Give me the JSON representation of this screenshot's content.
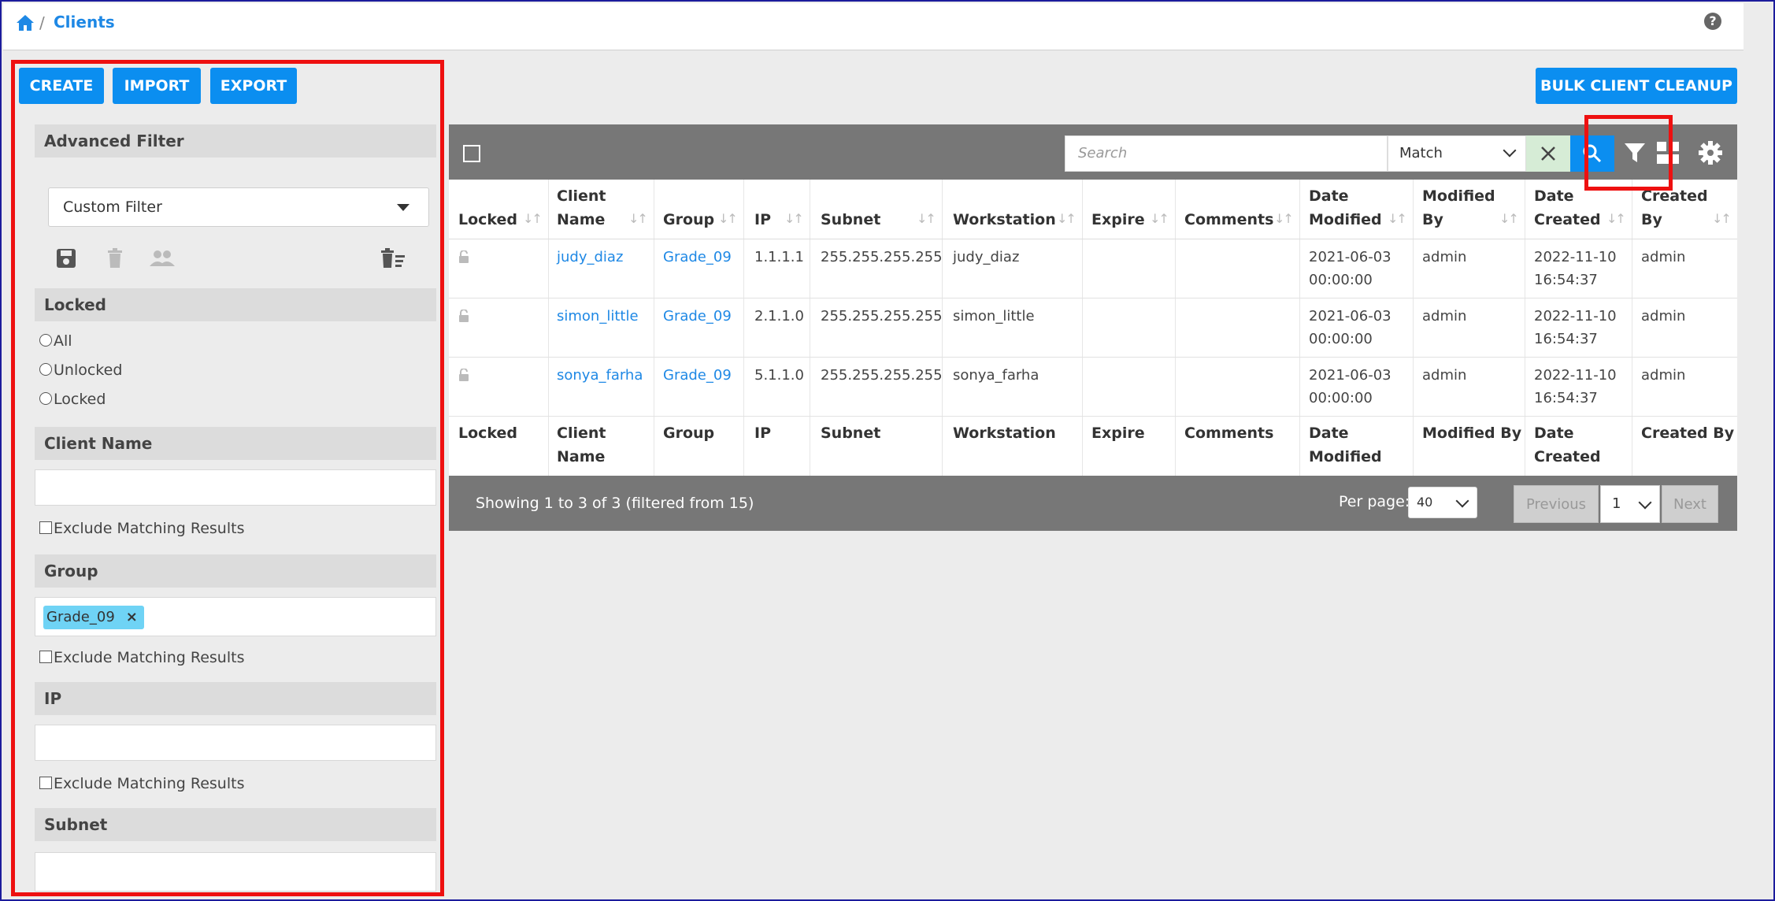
{
  "header": {
    "breadcrumb_sep": "/",
    "title": "Clients",
    "help": "?"
  },
  "actions": {
    "create": "CREATE",
    "import": "IMPORT",
    "export": "EXPORT",
    "bulk_cleanup": "BULK CLIENT CLEANUP"
  },
  "filter": {
    "title": "Advanced Filter",
    "selected_filter": "Custom Filter",
    "locked": {
      "title": "Locked",
      "options": [
        "All",
        "Unlocked",
        "Locked"
      ]
    },
    "client_name": {
      "title": "Client Name",
      "exclude": "Exclude Matching Results"
    },
    "group": {
      "title": "Group",
      "tag": "Grade_09",
      "tag_remove": "×",
      "exclude": "Exclude Matching Results"
    },
    "ip": {
      "title": "IP",
      "exclude": "Exclude Matching Results"
    },
    "subnet": {
      "title": "Subnet"
    }
  },
  "toolbar": {
    "search_placeholder": "Search",
    "match": "Match"
  },
  "table": {
    "headers": {
      "locked": "Locked",
      "client_name_1": "Client",
      "client_name_2": "Name",
      "group": "Group",
      "ip": "IP",
      "subnet": "Subnet",
      "workstation": "Workstation",
      "expire": "Expire",
      "comments": "Comments",
      "date_modified_1": "Date",
      "date_modified_2": "Modified",
      "modified_by_1": "Modified",
      "modified_by_2": "By",
      "date_created_1": "Date",
      "date_created_2": "Created",
      "created_by_1": "Created",
      "created_by_2": "By"
    },
    "footer": {
      "locked": "Locked",
      "client_name_1": "Client",
      "client_name_2": "Name",
      "group": "Group",
      "ip": "IP",
      "subnet": "Subnet",
      "workstation": "Workstation",
      "expire": "Expire",
      "comments": "Comments",
      "date_modified_1": "Date",
      "date_modified_2": "Modified",
      "modified_by": "Modified By",
      "date_created_1": "Date",
      "date_created_2": "Created",
      "created_by": "Created By"
    },
    "rows": [
      {
        "client_name": "judy_diaz",
        "group": "Grade_09",
        "ip": "1.1.1.1",
        "subnet": "255.255.255.255",
        "workstation": "judy_diaz",
        "date_modified_1": "2021-06-03",
        "date_modified_2": "00:00:00",
        "modified_by": "admin",
        "date_created_1": "2022-11-10",
        "date_created_2": "16:54:37",
        "created_by": "admin"
      },
      {
        "client_name": "simon_little",
        "group": "Grade_09",
        "ip": "2.1.1.0",
        "subnet": "255.255.255.255",
        "workstation": "simon_little",
        "date_modified_1": "2021-06-03",
        "date_modified_2": "00:00:00",
        "modified_by": "admin",
        "date_created_1": "2022-11-10",
        "date_created_2": "16:54:37",
        "created_by": "admin"
      },
      {
        "client_name": "sonya_farha",
        "group": "Grade_09",
        "ip": "5.1.1.0",
        "subnet": "255.255.255.255",
        "workstation": "sonya_farha",
        "date_modified_1": "2021-06-03",
        "date_modified_2": "00:00:00",
        "modified_by": "admin",
        "date_created_1": "2022-11-10",
        "date_created_2": "16:54:37",
        "created_by": "admin"
      }
    ]
  },
  "pagination": {
    "showing": "Showing 1 to 3 of 3 (filtered from 15)",
    "per_page_label": "Per page:",
    "per_page": "40",
    "previous": "Previous",
    "page": "1",
    "next": "Next"
  },
  "colors": {
    "accent": "#0b8ef0",
    "link": "#1e88e5",
    "annotation": "#ee1010",
    "toolbar": "#777777"
  }
}
